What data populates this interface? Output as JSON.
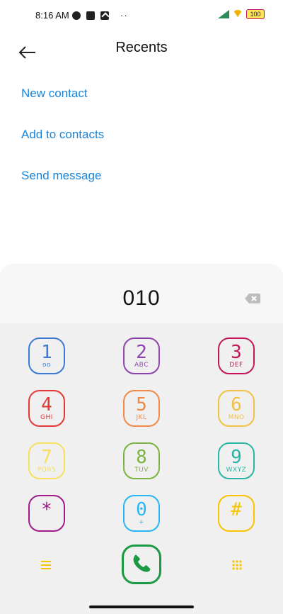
{
  "status_bar": {
    "time": "8:16 AM",
    "battery": "100"
  },
  "header": {
    "title": "Recents"
  },
  "actions": [
    {
      "label": "New contact"
    },
    {
      "label": "Add to contacts"
    },
    {
      "label": "Send message"
    }
  ],
  "dialer": {
    "number": "010",
    "keys": [
      {
        "digit": "1",
        "sub": "",
        "color": "#3a7bd5",
        "sub_icon": "voicemail-icon"
      },
      {
        "digit": "2",
        "sub": "ABC",
        "color": "#8e44ad"
      },
      {
        "digit": "3",
        "sub": "DEF",
        "color": "#c2185b"
      },
      {
        "digit": "4",
        "sub": "GHI",
        "color": "#e53935"
      },
      {
        "digit": "5",
        "sub": "JKL",
        "color": "#f08a44"
      },
      {
        "digit": "6",
        "sub": "MNO",
        "color": "#f2c043"
      },
      {
        "digit": "7",
        "sub": "PQRS",
        "color": "#f6e05e"
      },
      {
        "digit": "8",
        "sub": "TUV",
        "color": "#7cb342"
      },
      {
        "digit": "9",
        "sub": "WXYZ",
        "color": "#28b6a5"
      },
      {
        "digit": "*",
        "sub": "",
        "color": "#a01c8a"
      },
      {
        "digit": "0",
        "sub": "+",
        "color": "#29b6f6"
      },
      {
        "digit": "#",
        "sub": "",
        "color": "#f6c400"
      }
    ],
    "call_color": "#1b9a43",
    "accent_color": "#f6c400"
  }
}
